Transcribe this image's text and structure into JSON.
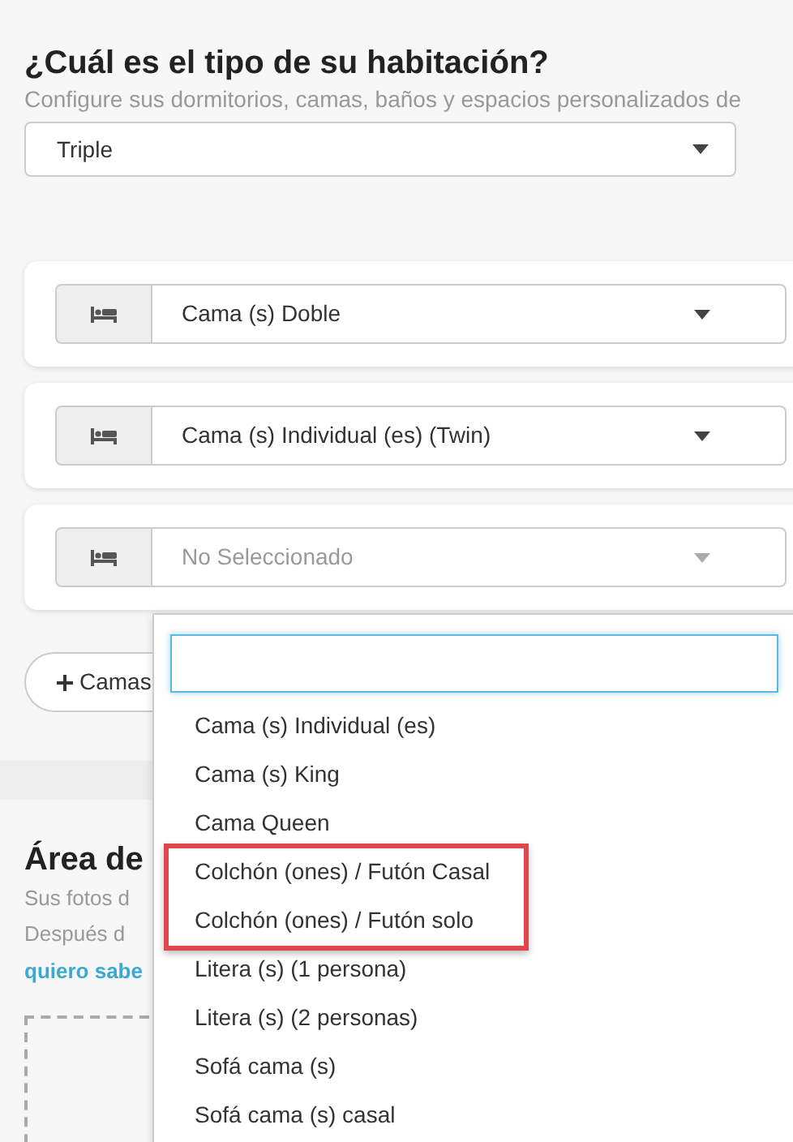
{
  "heading": "¿Cuál es el tipo de su habitación?",
  "subtitle": "Configure sus dormitorios, camas, baños y espacios personalizados de",
  "room_type": {
    "value": "Triple"
  },
  "beds": [
    {
      "value": "Cama (s) Doble"
    },
    {
      "value": "Cama (s) Individual (es) (Twin)"
    },
    {
      "placeholder": "No Seleccionado"
    }
  ],
  "add_button": {
    "label": "Camas"
  },
  "dropdown": {
    "options": [
      {
        "label": "Cama (s) Individual (es)",
        "highlighted": false
      },
      {
        "label": "Cama (s) King",
        "highlighted": false
      },
      {
        "label": "Cama Queen",
        "highlighted": false
      },
      {
        "label": "Colchón (ones) / Futón Casal",
        "highlighted": true
      },
      {
        "label": "Colchón (ones) / Futón solo",
        "highlighted": true
      },
      {
        "label": "Litera (s) (1 persona)",
        "highlighted": false
      },
      {
        "label": "Litera (s) (2 personas)",
        "highlighted": false
      },
      {
        "label": "Sofá cama (s)",
        "highlighted": false
      },
      {
        "label": "Sofá cama (s) casal",
        "highlighted": false
      }
    ]
  },
  "photos": {
    "title": "Área de",
    "lines": [
      "Sus fotos d",
      "Después d"
    ],
    "link": "quiero sabe"
  }
}
